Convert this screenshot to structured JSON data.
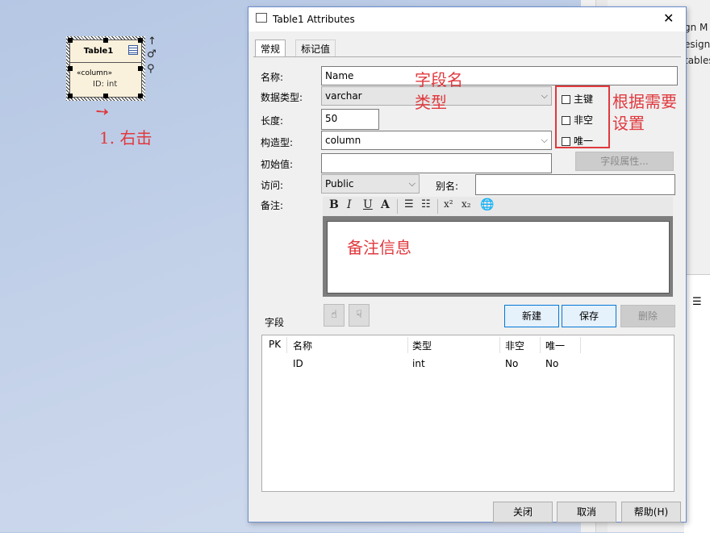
{
  "background_window": {
    "fragments": [
      "gn M",
      "esign",
      "tables"
    ]
  },
  "diagram": {
    "element": {
      "title": "Table1",
      "stereotype": "«column»",
      "attribute": "ID:  int",
      "icons": [
        "table-icon",
        "up-arrow-icon",
        "link-icon",
        "magnifier-icon"
      ]
    },
    "annotation_right_click": "1. 右击",
    "annotation_color": "#e0393e"
  },
  "dialog": {
    "title": "Table1 Attributes",
    "tabs": [
      {
        "label": "常规",
        "active": true
      },
      {
        "label": "标记值",
        "active": false
      }
    ],
    "form": {
      "name_label": "名称:",
      "name_value": "Name",
      "datatype_label": "数据类型:",
      "datatype_value": "varchar",
      "length_label": "长度:",
      "length_value": "50",
      "stereotype_label": "构造型:",
      "stereotype_value": "column",
      "initial_label": "初始值:",
      "initial_value": "",
      "field_props_button": "字段属性...",
      "access_label": "访问:",
      "access_value": "Public",
      "alias_label": "别名:",
      "alias_value": "",
      "notes_label": "备注:"
    },
    "checkboxes": [
      {
        "label": "主键",
        "checked": false
      },
      {
        "label": "非空",
        "checked": false
      },
      {
        "label": "唯一",
        "checked": false
      }
    ],
    "notes_toolbar": [
      "B",
      "I",
      "U",
      "A",
      "bullets",
      "numbering",
      "x²",
      "x₂",
      "hyperlink"
    ],
    "annotations": {
      "field_name": "字段名",
      "type": "类型",
      "set_as_needed": "根据需要设置",
      "notes_info": "备注信息"
    },
    "fields_section": {
      "label": "字段",
      "new_button": "新建",
      "save_button": "保存",
      "delete_button": "删除"
    },
    "grid": {
      "columns": [
        "PK",
        "名称",
        "类型",
        "非空",
        "唯一"
      ],
      "rows": [
        {
          "pk": "",
          "name": "ID",
          "type": "int",
          "not_null": "No",
          "unique": "No"
        }
      ]
    },
    "footer": {
      "close_button": "关闭",
      "cancel_button": "取消",
      "help_button": "帮助(H)"
    }
  }
}
